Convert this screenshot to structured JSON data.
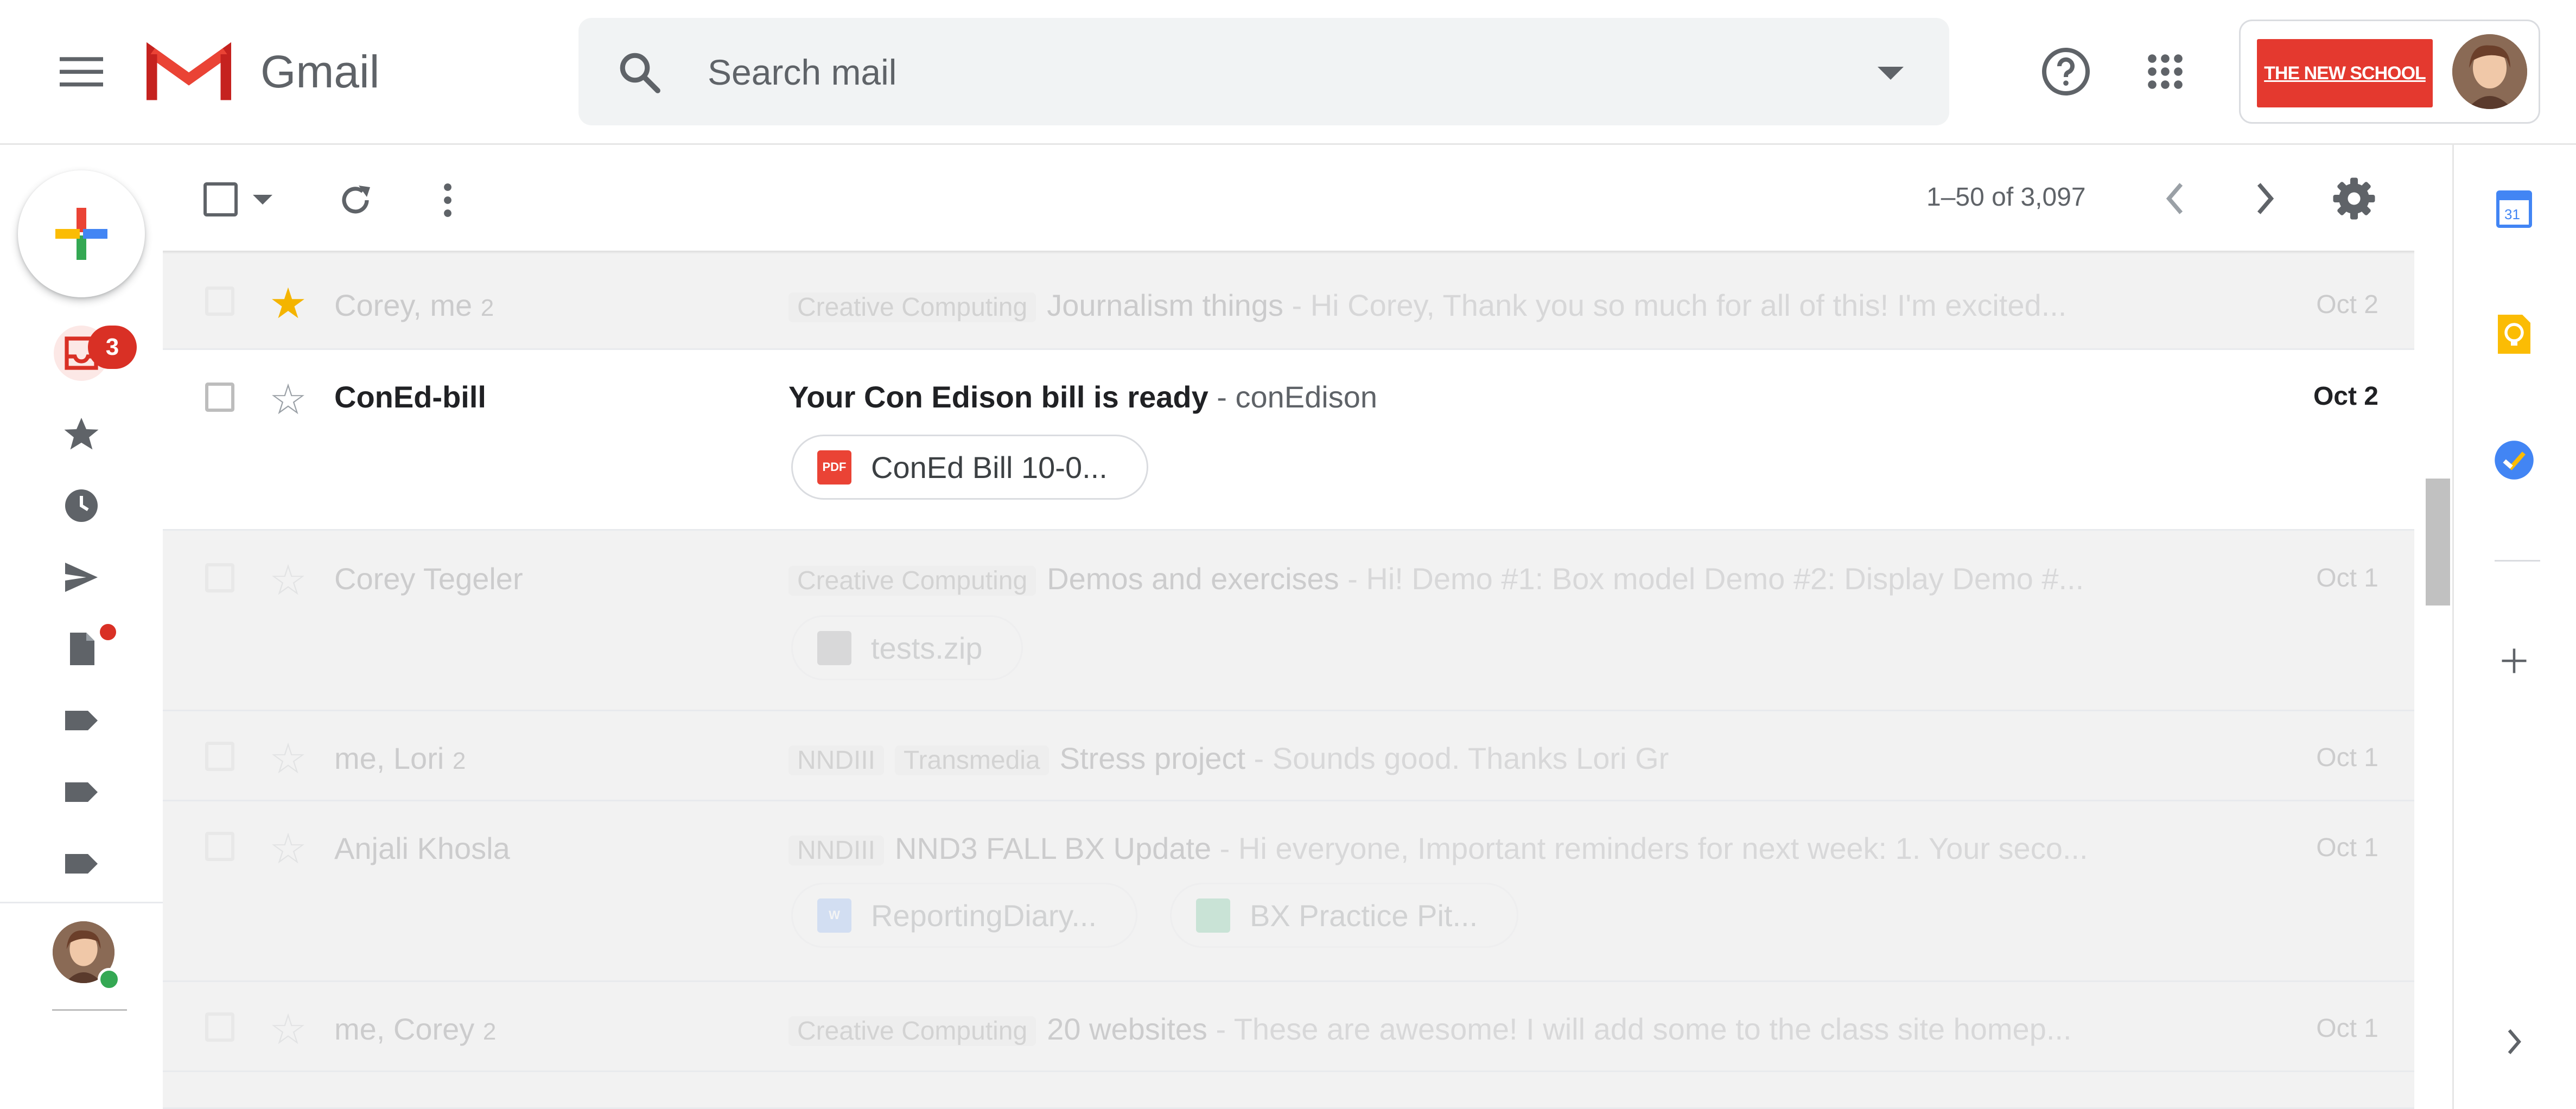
{
  "app": {
    "name": "Gmail"
  },
  "search": {
    "placeholder": "Search mail"
  },
  "account": {
    "org_logo_text": "THE NEW SCHOOL"
  },
  "nav": {
    "inbox_badge": "3"
  },
  "toolbar": {
    "page_count": "1–50 of 3,097"
  },
  "emails": [
    {
      "sender": "Corey, me",
      "thread_count": "2",
      "labels": [
        "Creative Computing"
      ],
      "subject": "Journalism things",
      "snippet": " - Hi Corey, Thank you so much for all of this! I'm excited...",
      "date": "Oct 2",
      "starred": true,
      "unread": false
    },
    {
      "sender": "ConEd-bill",
      "thread_count": "",
      "labels": [],
      "subject": "Your Con Edison bill is ready",
      "snippet": " - conEdison",
      "date": "Oct 2",
      "starred": false,
      "unread": true,
      "attachments": [
        {
          "name": "ConEd Bill 10-0...",
          "type": "PDF"
        }
      ]
    },
    {
      "sender": "Corey Tegeler",
      "thread_count": "",
      "labels": [
        "Creative Computing"
      ],
      "subject": "Demos and exercises",
      "snippet": " - Hi! Demo #1: Box model Demo #2: Display Demo #...",
      "date": "Oct 1",
      "starred": false,
      "unread": false,
      "attachments": [
        {
          "name": "tests.zip",
          "type": "ZIP"
        }
      ]
    },
    {
      "sender": "me, Lori",
      "thread_count": "2",
      "labels": [
        "NNDIII",
        "Transmedia"
      ],
      "subject": "Stress project",
      "snippet": " - Sounds good. Thanks Lori Gr",
      "date": "Oct 1",
      "starred": false,
      "unread": false
    },
    {
      "sender": "Anjali Khosla",
      "thread_count": "",
      "labels": [
        "NNDIII"
      ],
      "subject": "NND3 FALL BX Update",
      "snippet": " - Hi everyone, Important reminders for next week: 1. Your seco...",
      "date": "Oct 1",
      "starred": false,
      "unread": false,
      "attachments": [
        {
          "name": "ReportingDiary...",
          "type": "W"
        },
        {
          "name": "BX Practice Pit...",
          "type": "SHEET"
        }
      ]
    },
    {
      "sender": "me, Corey",
      "thread_count": "2",
      "labels": [
        "Creative Computing"
      ],
      "subject": "20 websites",
      "snippet": " - These are awesome! I will add some to the class site homep...",
      "date": "Oct 1",
      "starred": false,
      "unread": false
    }
  ],
  "side_panel": {
    "calendar_day": "31"
  },
  "colors": {
    "accent_red": "#d93025",
    "star_yellow": "#f4b400",
    "org_red": "#e4392f",
    "calendar_blue": "#4285f4",
    "keep_yellow": "#fbbc04"
  }
}
